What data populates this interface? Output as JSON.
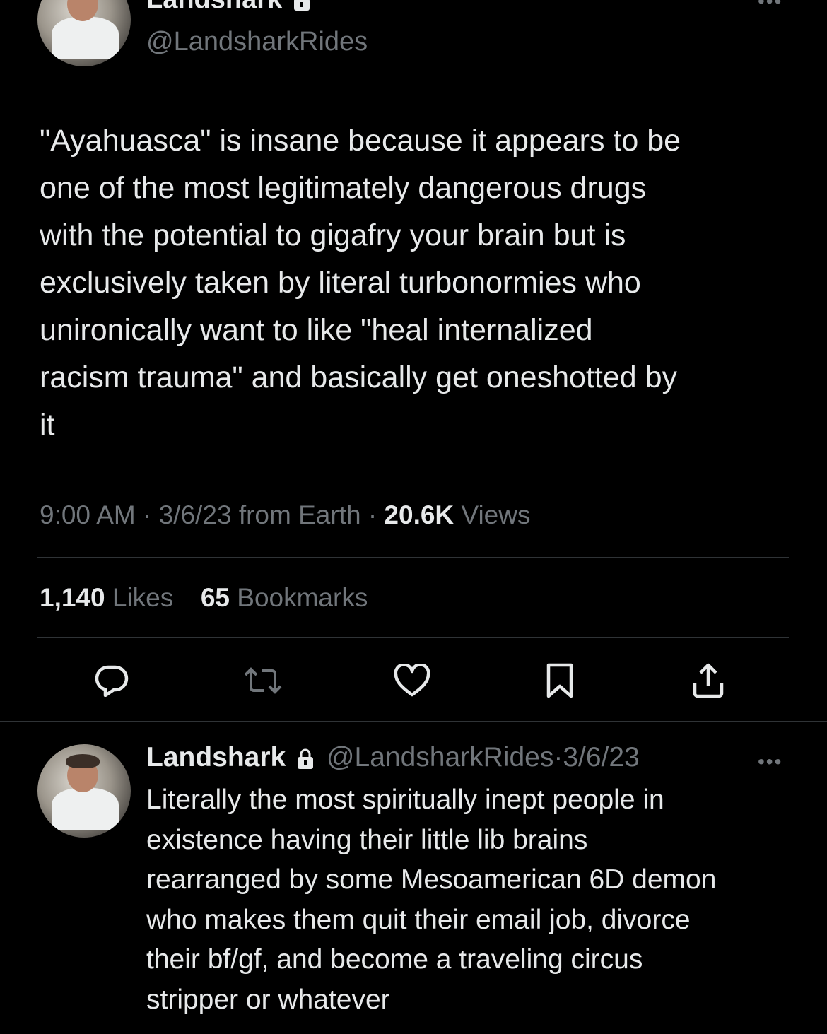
{
  "main_tweet": {
    "display_name": "Landshark",
    "handle": "@LandsharkRides",
    "text": "\"Ayahuasca\" is insane because it appears to be\none of the most legitimately dangerous drugs\nwith the potential to gigafry your brain but is\nexclusively taken by literal turbonormies who\nunironically want to like \"heal internalized\nracism trauma\" and basically get oneshotted by\nit",
    "time": "9:00 AM",
    "date": "3/6/23",
    "source": "from Earth",
    "views_count": "20.6K",
    "views_label": "Views",
    "likes_count": "1,140",
    "likes_label": "Likes",
    "bookmarks_count": "65",
    "bookmarks_label": "Bookmarks",
    "actions": [
      "reply-icon",
      "retweet-icon",
      "like-icon",
      "bookmark-icon",
      "share-icon"
    ]
  },
  "reply_tweet": {
    "display_name": "Landshark",
    "handle": "@LandsharkRides",
    "date": "3/6/23",
    "text": "Literally the most spiritually inept people in\nexistence having their little lib brains\nrearranged by some Mesoamerican 6D demon\nwho makes them quit their email job, divorce\ntheir bf/gf, and become a traveling circus\nstripper or whatever"
  },
  "separator": "·",
  "colors": {
    "background": "#000000",
    "text": "#e7e9ea",
    "muted": "#71767b",
    "divider": "#2f3336"
  }
}
